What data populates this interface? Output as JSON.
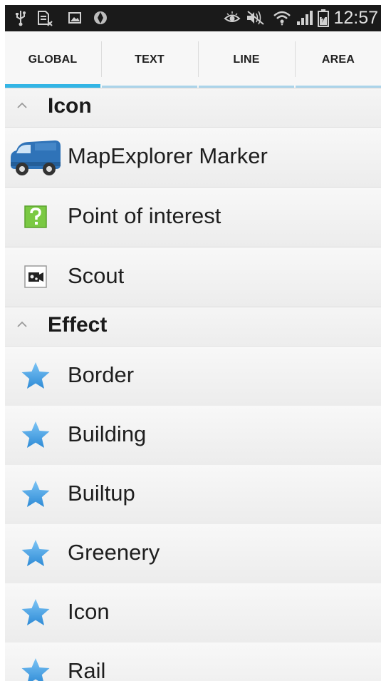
{
  "status_bar": {
    "time": "12:57",
    "icons": [
      "usb-icon",
      "sd-card-icon",
      "image-icon",
      "location-icon",
      "eye-icon",
      "mute-icon",
      "wifi-icon",
      "signal-icon",
      "battery-icon"
    ]
  },
  "tabs": [
    {
      "label": "GLOBAL",
      "active": true
    },
    {
      "label": "TEXT",
      "active": false
    },
    {
      "label": "LINE",
      "active": false
    },
    {
      "label": "AREA",
      "active": false
    }
  ],
  "sections": [
    {
      "title": "Icon",
      "items": [
        {
          "label": "MapExplorer Marker",
          "icon": "truck-icon"
        },
        {
          "label": "Point of interest",
          "icon": "question-mark-icon"
        },
        {
          "label": "Scout",
          "icon": "camera-icon"
        }
      ]
    },
    {
      "title": "Effect",
      "items": [
        {
          "label": "Border",
          "icon": "star-icon"
        },
        {
          "label": "Building",
          "icon": "star-icon"
        },
        {
          "label": "Builtup",
          "icon": "star-icon"
        },
        {
          "label": "Greenery",
          "icon": "star-icon"
        },
        {
          "label": "Icon",
          "icon": "star-icon"
        },
        {
          "label": "Rail",
          "icon": "star-icon"
        }
      ]
    }
  ],
  "colors": {
    "accent": "#33b5e5",
    "status_bar": "#1a1a1a",
    "star": "#4aa8e8",
    "poi_green": "#7ac943"
  }
}
